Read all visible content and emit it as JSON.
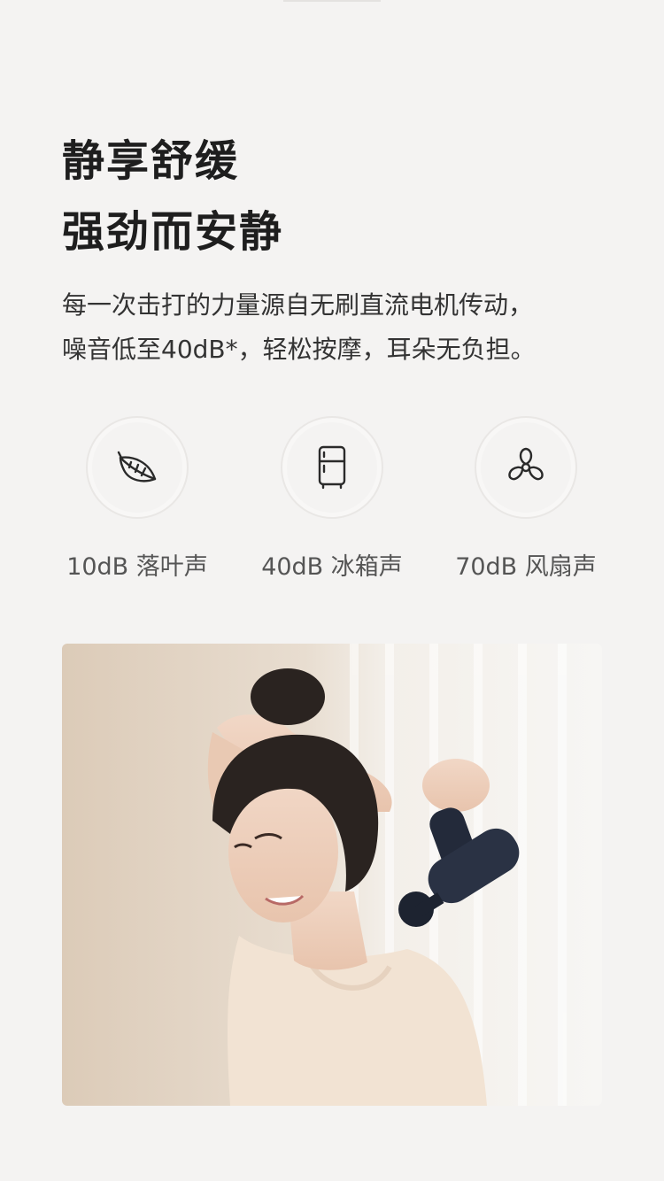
{
  "headline": {
    "line1": "静享舒缓",
    "line2": "强劲而安静"
  },
  "description": {
    "line1": "每一次击打的力量源自无刷直流电机传动，",
    "line2": "噪音低至40dB*，轻松按摩，耳朵无负担。"
  },
  "noise_levels": [
    {
      "label": "10dB 落叶声",
      "icon": "leaf-icon"
    },
    {
      "label": "40dB 冰箱声",
      "icon": "fridge-icon"
    },
    {
      "label": "70dB 风扇声",
      "icon": "fan-icon"
    }
  ],
  "photo": {
    "subject": "woman-using-massage-gun-photo"
  }
}
